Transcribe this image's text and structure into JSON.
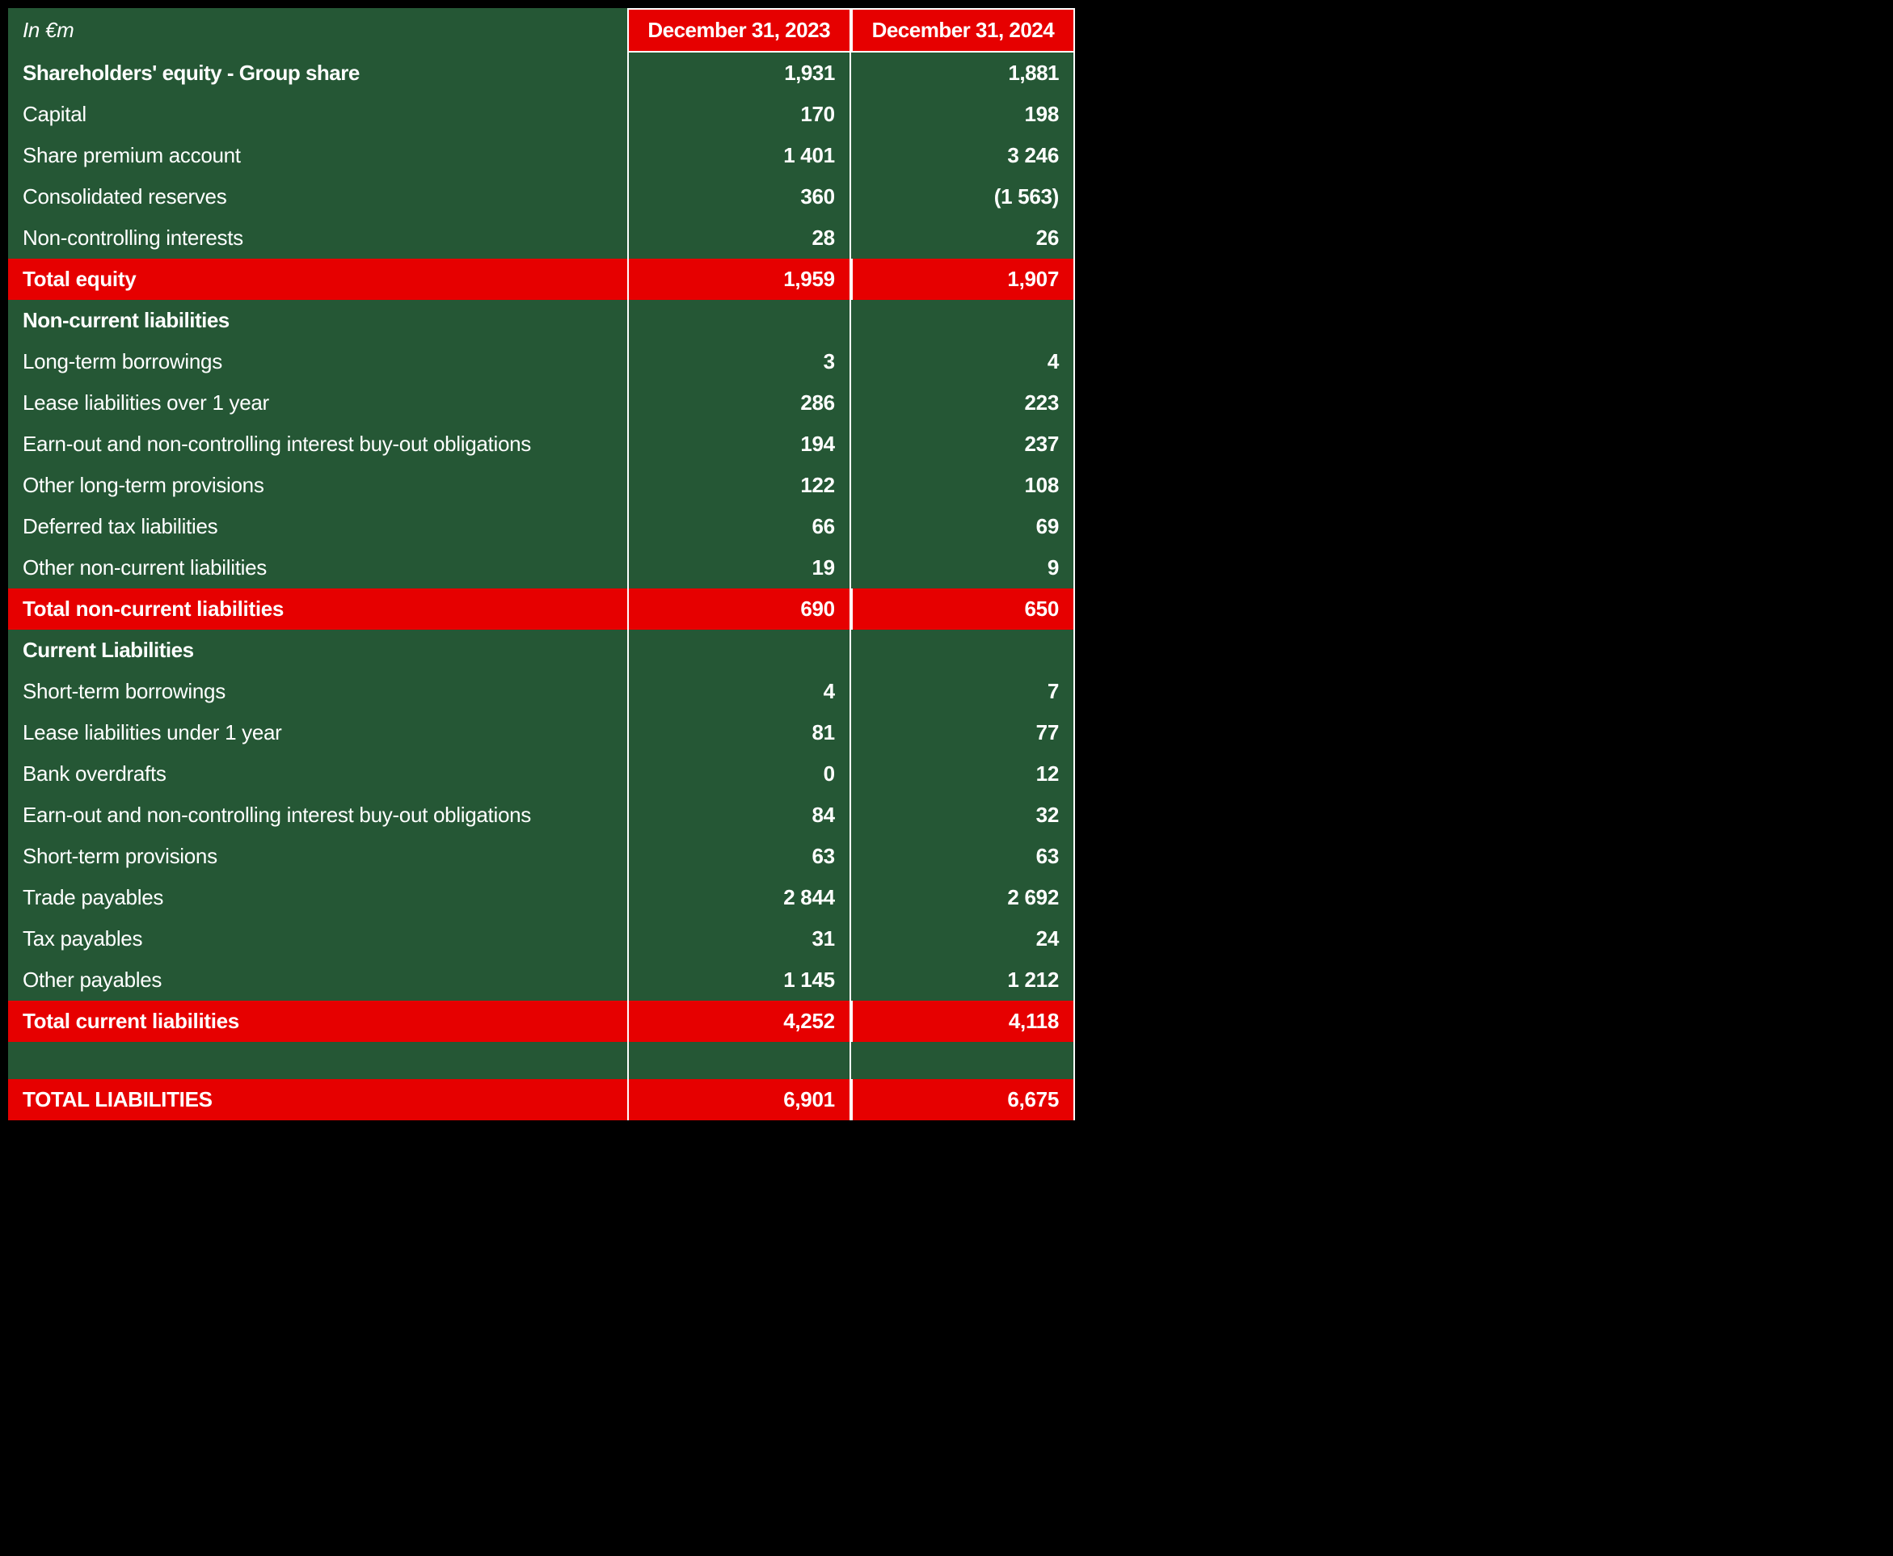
{
  "header": {
    "label": "In €m",
    "col1": "December 31, 2023",
    "col2": "December 31, 2024"
  },
  "rows": [
    {
      "type": "bold",
      "label": "Shareholders' equity - Group share",
      "v1": "1,931",
      "v2": "1,881"
    },
    {
      "type": "normal",
      "label": "Capital",
      "v1": "170",
      "v2": "198"
    },
    {
      "type": "normal",
      "label": "Share premium account",
      "v1": "1 401",
      "v2": "3 246"
    },
    {
      "type": "normal",
      "label": "Consolidated reserves",
      "v1": "360",
      "v2": "(1 563)"
    },
    {
      "type": "normal",
      "label": "Non-controlling interests",
      "v1": "28",
      "v2": "26"
    },
    {
      "type": "red",
      "label": "Total equity",
      "v1": "1,959",
      "v2": "1,907"
    },
    {
      "type": "section",
      "label": "Non-current liabilities",
      "v1": "",
      "v2": ""
    },
    {
      "type": "normal",
      "label": "Long-term borrowings",
      "v1": "3",
      "v2": "4"
    },
    {
      "type": "normal",
      "label": "Lease liabilities over 1 year",
      "v1": "286",
      "v2": "223"
    },
    {
      "type": "normal",
      "label": "Earn-out and non-controlling interest buy-out obligations",
      "v1": "194",
      "v2": "237"
    },
    {
      "type": "normal",
      "label": "Other long-term provisions",
      "v1": "122",
      "v2": "108"
    },
    {
      "type": "normal",
      "label": "Deferred tax liabilities",
      "v1": "66",
      "v2": "69"
    },
    {
      "type": "normal",
      "label": "Other non-current liabilities",
      "v1": "19",
      "v2": "9"
    },
    {
      "type": "red",
      "label": "Total non-current liabilities",
      "v1": "690",
      "v2": "650"
    },
    {
      "type": "section",
      "label": "Current Liabilities",
      "v1": "",
      "v2": ""
    },
    {
      "type": "normal",
      "label": "Short-term borrowings",
      "v1": "4",
      "v2": "7"
    },
    {
      "type": "normal",
      "label": "Lease liabilities under 1 year",
      "v1": "81",
      "v2": "77"
    },
    {
      "type": "normal",
      "label": "Bank overdrafts",
      "v1": "0",
      "v2": "12"
    },
    {
      "type": "normal",
      "label": "Earn-out and non-controlling interest buy-out obligations",
      "v1": "84",
      "v2": "32"
    },
    {
      "type": "normal",
      "label": "Short-term provisions",
      "v1": "63",
      "v2": "63"
    },
    {
      "type": "normal",
      "label": "Trade payables",
      "v1": "2 844",
      "v2": "2 692"
    },
    {
      "type": "normal",
      "label": "Tax payables",
      "v1": "31",
      "v2": "24"
    },
    {
      "type": "normal",
      "label": "Other payables",
      "v1": "1 145",
      "v2": "1 212"
    },
    {
      "type": "red",
      "label": "Total current liabilities",
      "v1": "4,252",
      "v2": "4,118"
    },
    {
      "type": "empty",
      "label": "",
      "v1": "",
      "v2": ""
    },
    {
      "type": "red",
      "label": "TOTAL LIABILITIES",
      "v1": "6,901",
      "v2": "6,675"
    }
  ]
}
